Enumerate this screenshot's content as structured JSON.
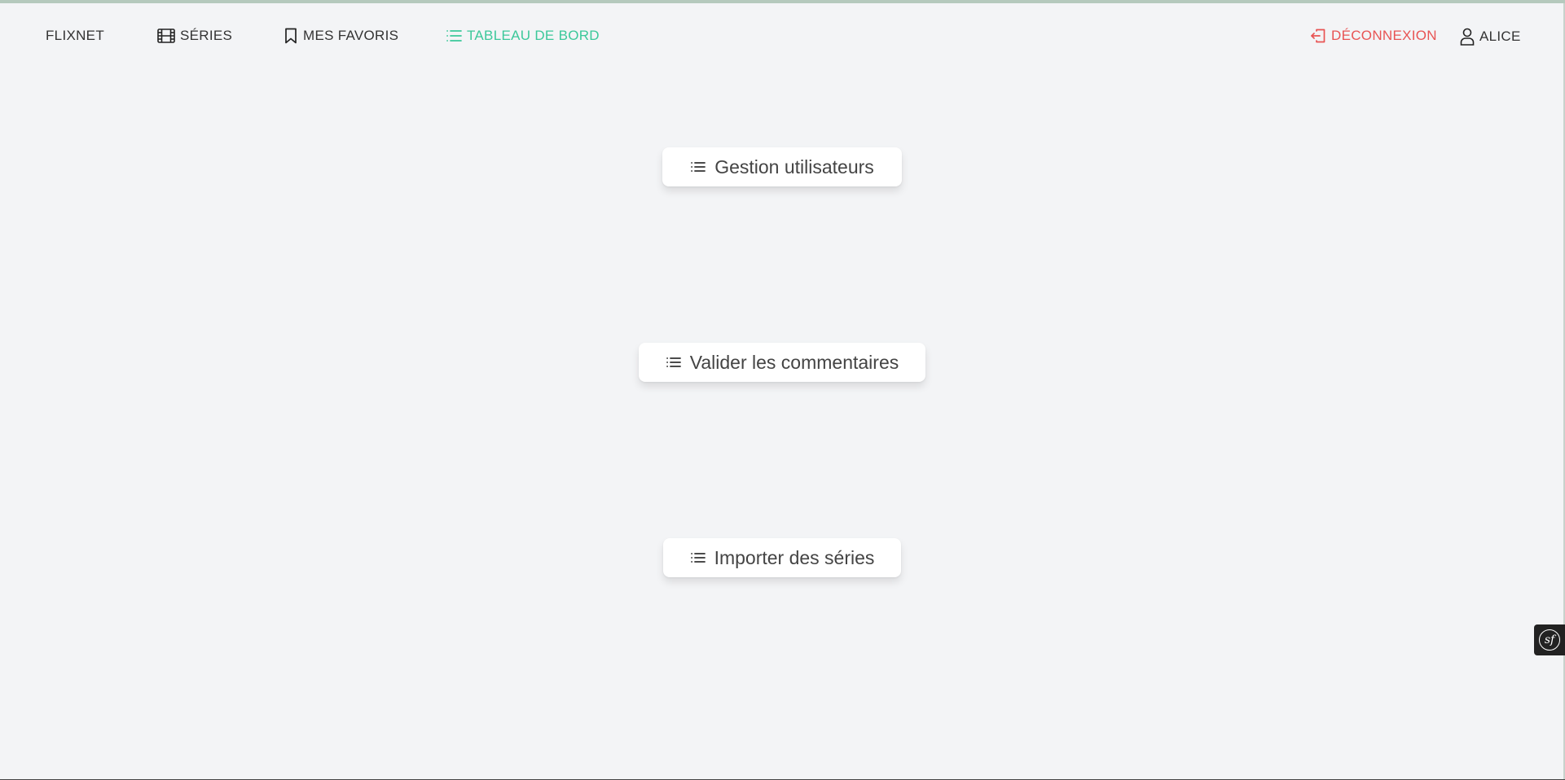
{
  "nav": {
    "brand": "FLIXNET",
    "series": "SÉRIES",
    "favoris": "MES FAVORIS",
    "dashboard": "TABLEAU DE BORD",
    "logout": "DÉCONNEXION",
    "user": "ALICE"
  },
  "dashboard": {
    "users_button": "Gestion utilisateurs",
    "comments_button": "Valider les commentaires",
    "import_button": "Importer des séries"
  },
  "toolbar": {
    "symfony_label": "sf"
  },
  "colors": {
    "active": "#3cc89a",
    "logout": "#e85454",
    "background": "#f3f4f6"
  }
}
